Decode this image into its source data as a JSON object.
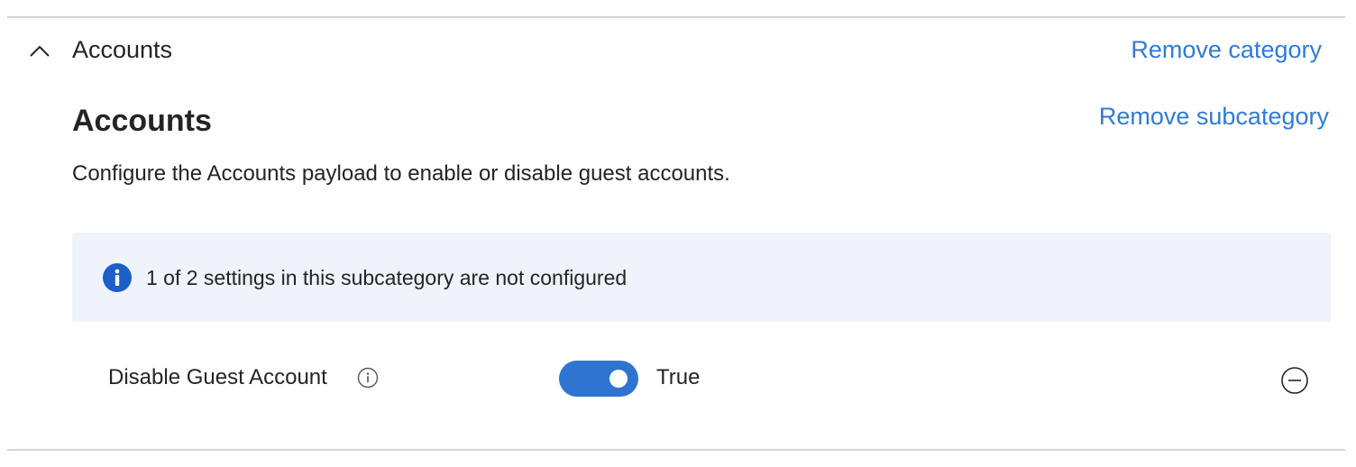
{
  "category": {
    "title": "Accounts",
    "remove_label": "Remove category",
    "expanded": true
  },
  "subcategory": {
    "title": "Accounts",
    "remove_label": "Remove subcategory",
    "description": "Configure the Accounts payload to enable or disable guest accounts."
  },
  "info_banner": {
    "icon": "info-icon",
    "text": "1 of 2 settings in this subcategory are not configured"
  },
  "settings": [
    {
      "label": "Disable Guest Account",
      "value_label": "True",
      "enabled": true
    }
  ],
  "colors": {
    "link": "#2f7bd8",
    "toggle_on": "#2f74d0",
    "banner_bg": "#eff4fc",
    "info_icon": "#1c5fc6"
  }
}
